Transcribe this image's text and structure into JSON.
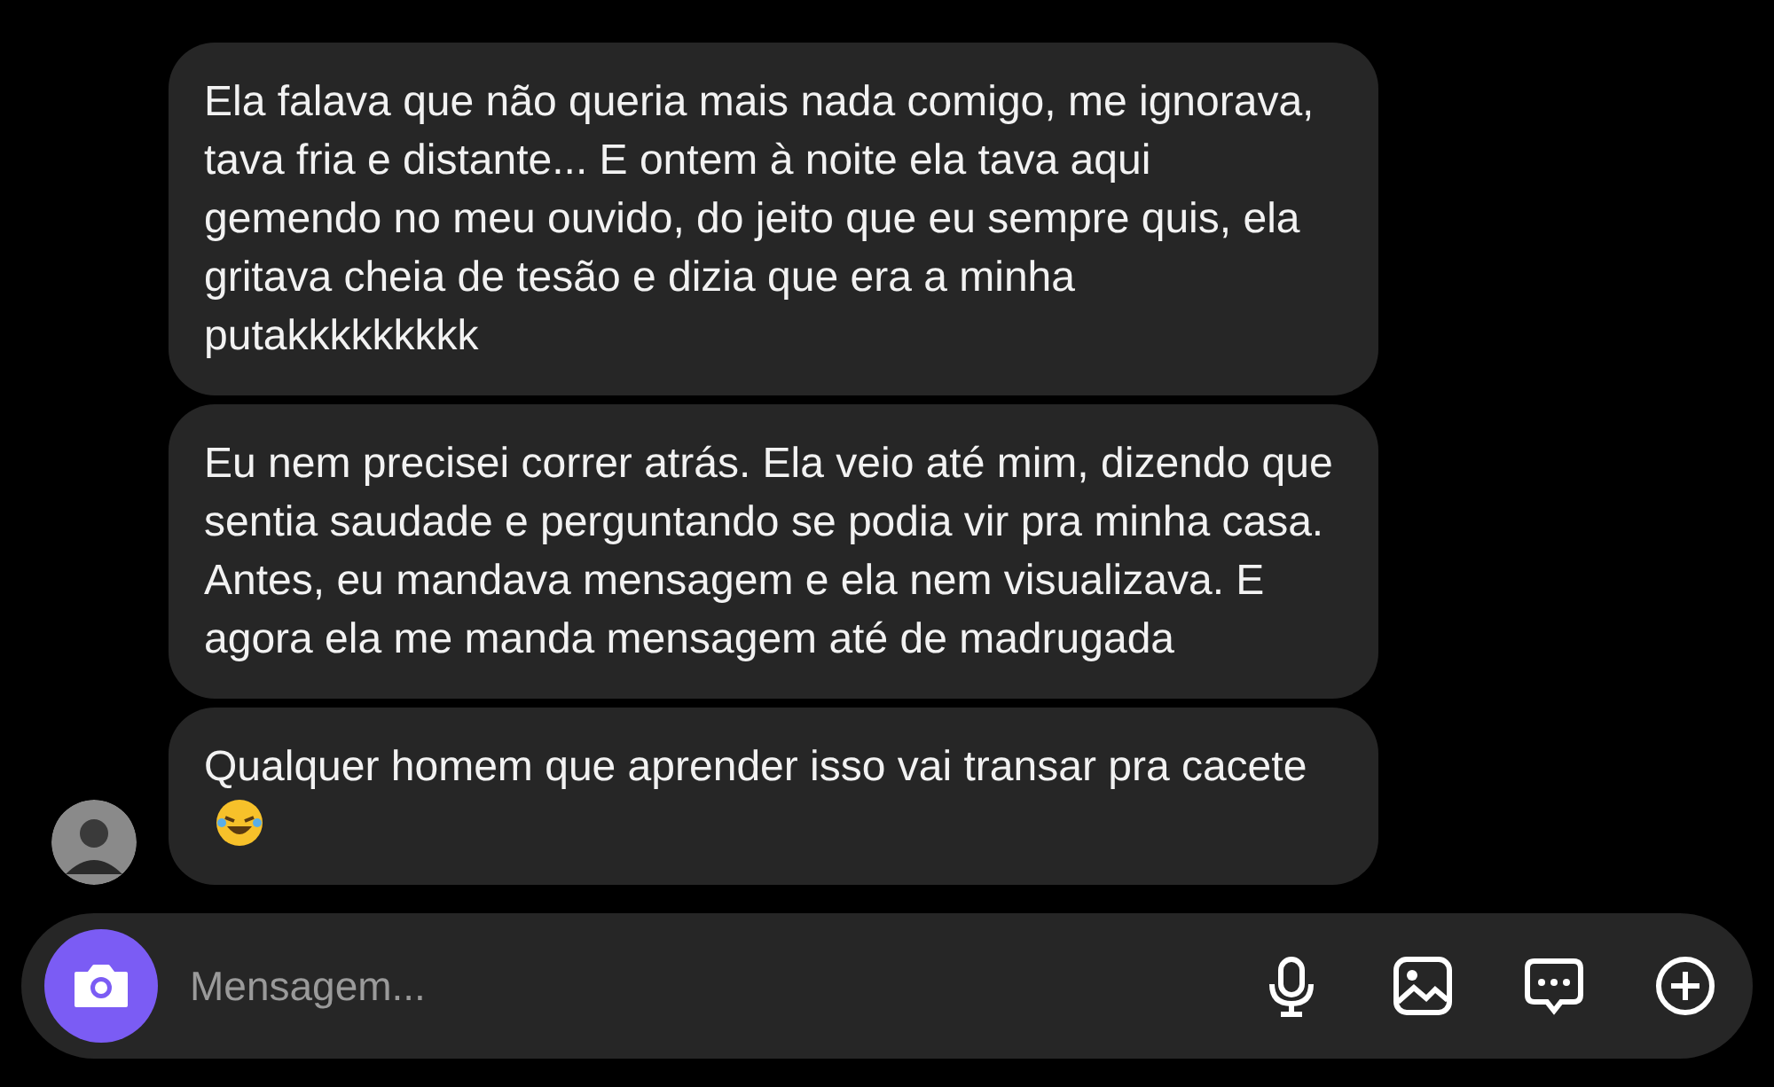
{
  "messages": [
    {
      "text": "Ela falava que não queria mais nada comigo, me ignorava, tava fria e distante... E ontem à noite ela tava aqui gemendo no meu ouvido, do jeito que eu sempre quis, ela gritava cheia de tesão e dizia que era a minha putakkkkkkkkk",
      "emoji": false,
      "avatar": false
    },
    {
      "text": "Eu nem precisei correr atrás. Ela veio até mim, dizendo que sentia saudade e perguntando se podia vir pra minha casa. Antes, eu mandava mensagem e ela nem visualizava. E agora ela me manda mensagem até de madrugada",
      "emoji": false,
      "avatar": false
    },
    {
      "text": "Qualquer homem que aprender isso vai transar pra cacete",
      "emoji": true,
      "avatar": true
    }
  ],
  "composer": {
    "placeholder": "Mensagem..."
  }
}
